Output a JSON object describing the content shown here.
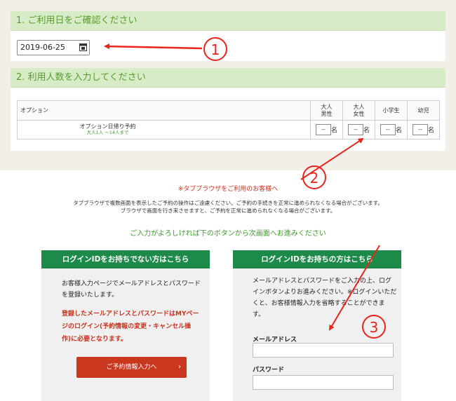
{
  "sections": {
    "date_title": "1. ご利用日をご確認ください",
    "date_value": "2019-06-25",
    "people_title": "2. 利用人数を入力してください"
  },
  "table": {
    "headers": {
      "option": "オプション",
      "adult_male": [
        "大人",
        "男性"
      ],
      "adult_female": [
        "大人",
        "女性"
      ],
      "child": "小学生",
      "infant": "幼児"
    },
    "row": {
      "name": "オプション日帰り予約",
      "sub": "大人1人 〜14人まで",
      "placeholder": "--",
      "unit": "名"
    }
  },
  "notice": {
    "title": "※タブブラウザをご利用のお客様へ",
    "line1": "タブブラウザで複数画面を表示したご予約の操作はご遠慮ください。ご予約の手続きを正常に進められなくなる場合がございます。",
    "line2": "ブラウザで画面を行き来させますと、ご予約を正常に進められなくなる場合がございます。",
    "proceed": "ご入力がよろしければ下のボタンから次画面へお進みください"
  },
  "left_box": {
    "title": "ログインIDをお持ちでない方はこちら",
    "text_lines": [
      "お客様入力ページでメールアドレスとパスワード",
      "を登録いたします。"
    ],
    "red_lines": [
      "登録したメールアドレスとパスワードはMYペー",
      "ジのログイン(予約情報の変更・キャンセル操",
      "作)に必要となります。"
    ],
    "button": "ご予約情報入力へ",
    "button_arrow": "›"
  },
  "right_box": {
    "title": "ログインIDをお持ちの方はこちら",
    "text_lines": [
      "メールアドレスとパスワードをご入力の上、ログ",
      "インボタンよりお進みください。※ログインいただ",
      "くと、お客様情報入力を省略することができま",
      "す。"
    ],
    "email_label": "メールアドレス",
    "password_label": "パスワード"
  },
  "annotations": [
    "①",
    "②",
    "③"
  ],
  "colors": {
    "annotation": "#e8241c",
    "header_bg": "#d7ecc6",
    "login_head": "#1d8a4a",
    "cta": "#c9371f"
  }
}
